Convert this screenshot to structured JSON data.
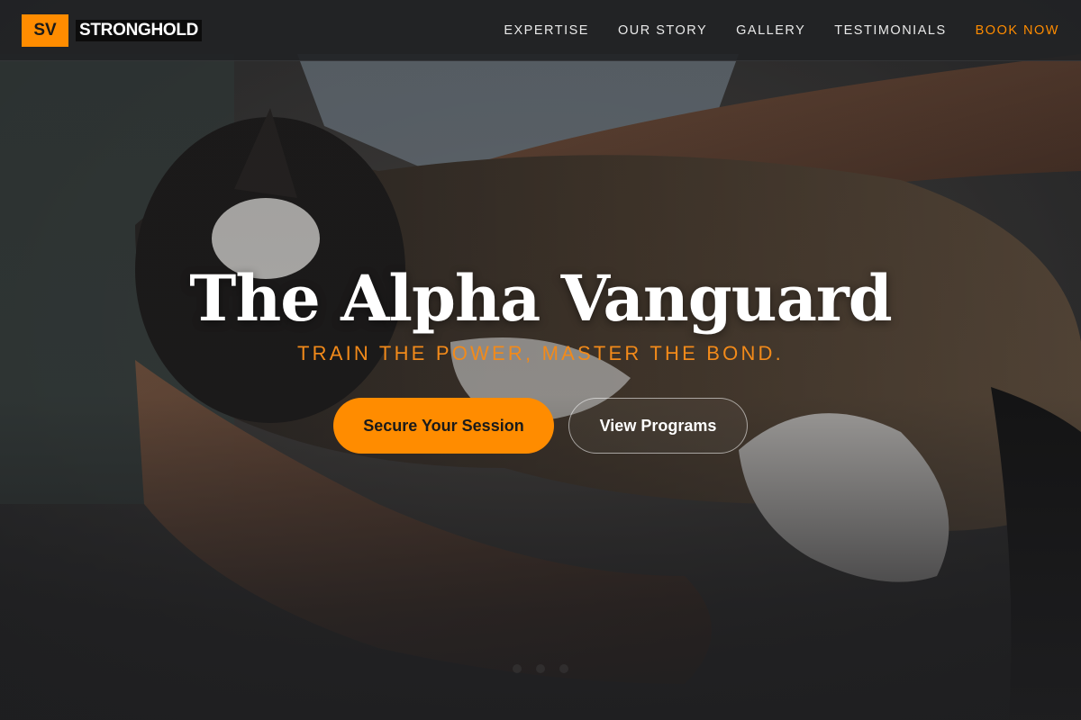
{
  "brand": {
    "mark": "SV",
    "name": "STRONGHOLD"
  },
  "nav": {
    "items": [
      {
        "label": "EXPERTISE"
      },
      {
        "label": "OUR STORY"
      },
      {
        "label": "GALLERY"
      },
      {
        "label": "TESTIMONIALS"
      }
    ],
    "cta_label": "BOOK NOW"
  },
  "hero": {
    "title": "The Alpha Vanguard",
    "subtitle": "TRAIN THE POWER, MASTER THE BOND.",
    "primary_button": "Secure Your Session",
    "secondary_button": "View Programs",
    "background_image": "cat-being-petted-photo"
  },
  "colors": {
    "accent": "#ff8c00",
    "header_bg": "#222325",
    "text": "#ffffff"
  }
}
